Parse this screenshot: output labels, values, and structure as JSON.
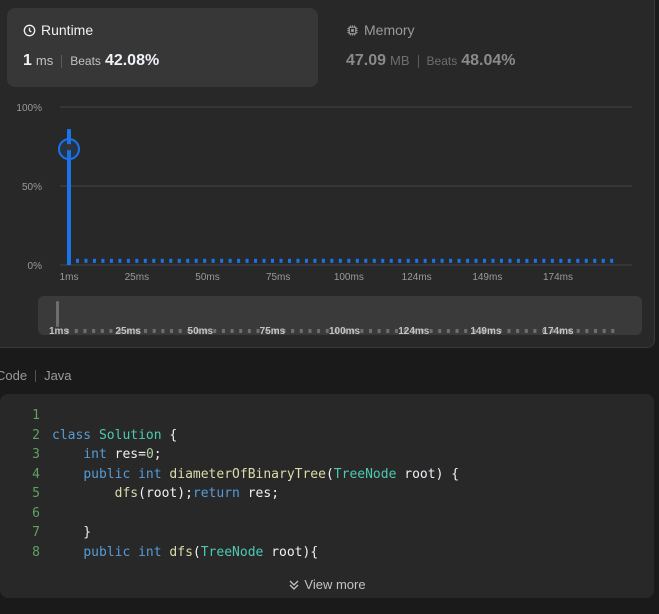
{
  "runtime": {
    "title": "Runtime",
    "value": "1",
    "unit": "ms",
    "beats_label": "Beats",
    "beats_value": "42.08%"
  },
  "memory": {
    "title": "Memory",
    "value": "47.09",
    "unit": "MB",
    "beats_label": "Beats",
    "beats_value": "48.04%"
  },
  "chart_data": {
    "type": "bar",
    "y_ticks": [
      "100%",
      "50%",
      "0%"
    ],
    "ylim": [
      0,
      100
    ],
    "x_ticks": [
      "1ms",
      "25ms",
      "50ms",
      "75ms",
      "100ms",
      "124ms",
      "149ms",
      "174ms"
    ],
    "x_tick_values": [
      1,
      25,
      50,
      75,
      100,
      124,
      149,
      174
    ],
    "x_range": [
      1,
      195
    ],
    "highlight_x": 1,
    "highlight_y": 86,
    "baseline_y": 2,
    "accent": "#1a73e8",
    "grid": true
  },
  "range_slider": {
    "x_ticks": [
      "1ms",
      "25ms",
      "50ms",
      "75ms",
      "100ms",
      "124ms",
      "149ms",
      "174ms"
    ]
  },
  "code": {
    "label": "Code",
    "language": "Java",
    "lines": [
      "",
      "class Solution {",
      "    int res=0;",
      "    public int diameterOfBinaryTree(TreeNode root) {",
      "        dfs(root);return res;",
      "",
      "    }",
      "    public int dfs(TreeNode root){"
    ],
    "view_more": "View more"
  }
}
